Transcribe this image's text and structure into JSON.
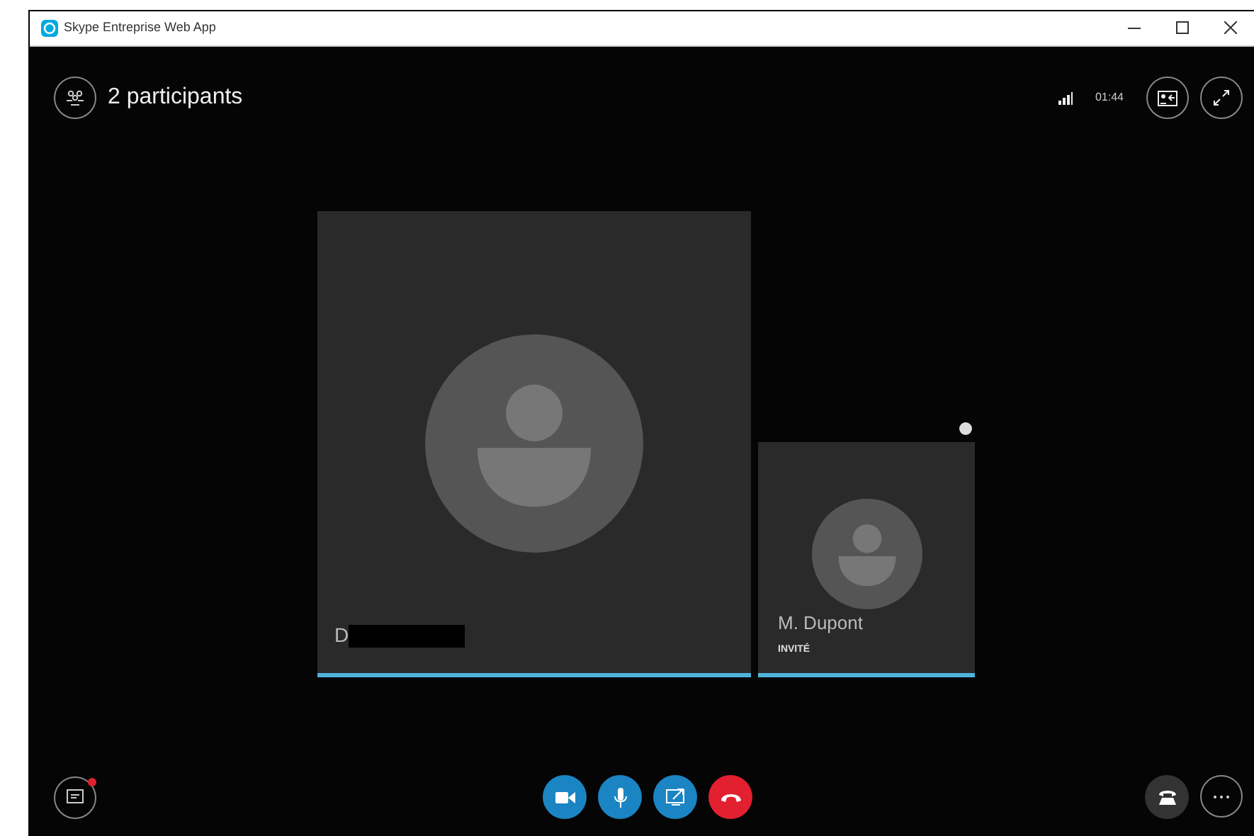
{
  "window": {
    "title": "Skype Entreprise Web App"
  },
  "header": {
    "participants": "2 participants",
    "time": "01:44"
  },
  "tiles": [
    {
      "kind": "main",
      "name": "D",
      "redacted": true
    },
    {
      "kind": "secondary",
      "name": "M. Dupont",
      "role": "INVITÉ",
      "redacted": false
    }
  ],
  "chat": {
    "notification": true
  },
  "controls": [
    {
      "kind": "video"
    },
    {
      "kind": "mic"
    },
    {
      "kind": "share"
    },
    {
      "kind": "hangup"
    }
  ],
  "right_controls": [
    {
      "kind": "dialpad"
    },
    {
      "kind": "more"
    }
  ]
}
